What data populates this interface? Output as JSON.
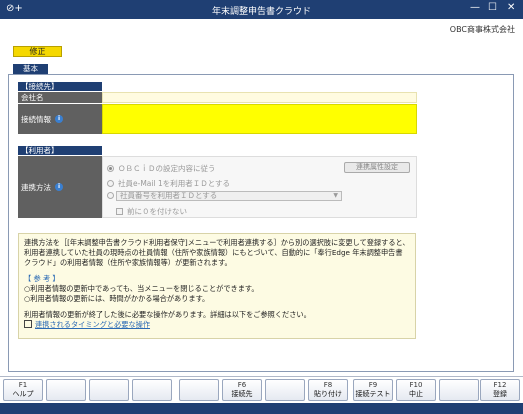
{
  "titlebar": {
    "app_icon": "⊘+",
    "title": "年末調整申告書クラウド",
    "min": "—",
    "max": "☐",
    "close": "✕"
  },
  "company": "OBC商事株式会社",
  "mode_badge": "修正",
  "tab": "基本",
  "connection": {
    "heading": "【接続先】",
    "company_label": "会社名",
    "company_value": "",
    "info_label": "接続情報",
    "info_value": ""
  },
  "user": {
    "heading": "【利用者】",
    "link_label": "連携方法",
    "options": [
      "ＯＢＣｉＤの設定内容に従う",
      "社員e-Mail 1を利用者ＩＤとする",
      ""
    ],
    "select_value": "社員番号を利用者ＩＤとする",
    "checkbox_label": "前に０を付けない",
    "attr_button": "連携属性設定"
  },
  "note": {
    "lines": [
      "連携方法を［[年末調整申告書クラウド利用者保守]メニューで利用者連携する］から別の選択肢に変更して登録すると、",
      "利用者連携していた社員の現時点の社員情報（住所や家族情報）にもとづいて、自動的に「奉行Edge 年末調整申告書",
      "クラウド」の利用者情報（住所や家族情報等）が更新されます。"
    ],
    "ref_title": "【 参 考 】",
    "ref_lines": [
      "○利用者情報の更新中であっても、当メニューを閉じることができます。",
      "○利用者情報の更新には、時間がかかる場合があります。"
    ],
    "tail": "利用者情報の更新が終了した後に必要な操作があります。詳細は以下をご参照ください。",
    "link": "連携されるタイミングと必要な操作"
  },
  "fkeys": [
    {
      "key": "F1",
      "name": "ヘルプ"
    },
    {
      "key": "",
      "name": ""
    },
    {
      "key": "",
      "name": ""
    },
    {
      "key": "",
      "name": ""
    },
    {
      "key": "",
      "name": ""
    },
    {
      "key": "F6",
      "name": "接続先"
    },
    {
      "key": "",
      "name": ""
    },
    {
      "key": "F8",
      "name": "貼り付け"
    },
    {
      "key": "F9",
      "name": "接続テスト"
    },
    {
      "key": "F10",
      "name": "中止"
    },
    {
      "key": "",
      "name": ""
    },
    {
      "key": "F12",
      "name": "登録"
    }
  ],
  "colors": {
    "titlebar": "#1f3f73",
    "mode_badge": "#f5d800",
    "required_field": "#ffff00",
    "label_bg": "#606060",
    "note_bg": "#fdfbe3"
  }
}
